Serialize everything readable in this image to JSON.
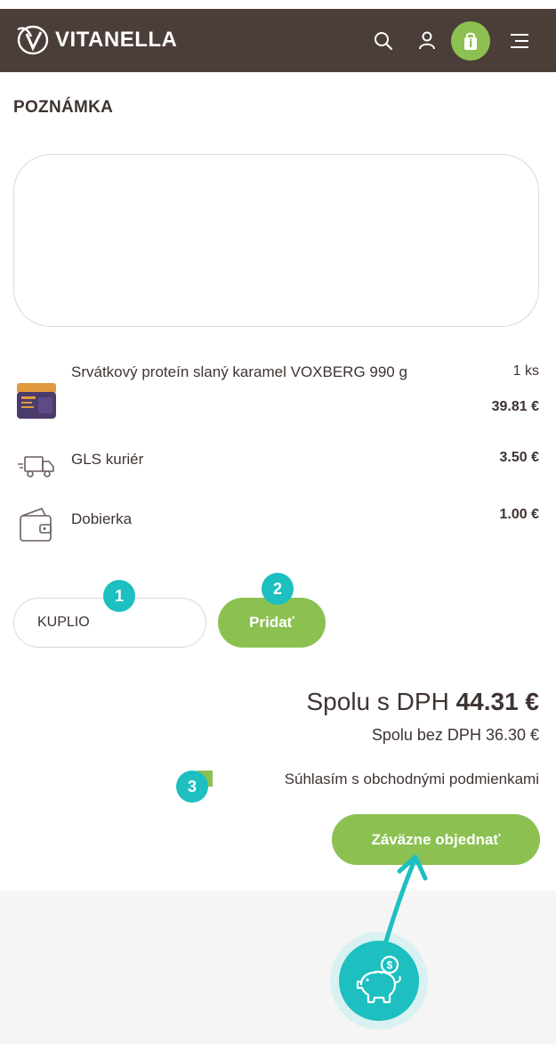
{
  "header": {
    "brand": "VITANELLA",
    "icons": [
      "search-icon",
      "user-icon",
      "cart-icon",
      "menu-icon"
    ]
  },
  "note": {
    "title": "POZNÁMKA",
    "value": ""
  },
  "items": [
    {
      "name": "Srvátkový proteín slaný karamel VOXBERG 990 g",
      "quantity": "1 ks",
      "price": "39.81 €"
    },
    {
      "name": "GLS kuriér",
      "price": "3.50 €"
    },
    {
      "name": "Dobierka",
      "price": "1.00 €"
    }
  ],
  "coupon": {
    "value": "KUPLIO",
    "button": "Pridať"
  },
  "totals": {
    "with_vat_label": "Spolu s DPH",
    "with_vat_value": "44.31 €",
    "without_vat": "Spolu bez DPH 36.30 €"
  },
  "terms": {
    "label": "Súhlasím s obchodnými podmienkami",
    "checked": true
  },
  "order_button": "Záväzne objednať",
  "annotations": [
    "1",
    "2",
    "3"
  ],
  "colors": {
    "header": "#4b3e39",
    "green": "#8cc152",
    "teal": "#1dbfc1",
    "text": "#3f3432"
  }
}
